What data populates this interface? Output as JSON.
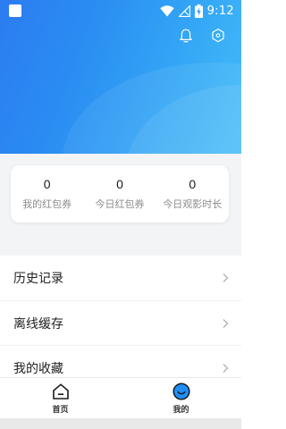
{
  "status_bar": {
    "time": "9:12",
    "icons": [
      "app-notification-icon",
      "wifi-icon",
      "no-signal-icon",
      "battery-charging-icon"
    ]
  },
  "header": {
    "icons": [
      "bell-icon",
      "settings-hexagon-icon"
    ],
    "gradient_colors": [
      "#2c7cf0",
      "#45bdf8"
    ]
  },
  "stats": [
    {
      "value": "0",
      "label": "我的红包券"
    },
    {
      "value": "0",
      "label": "今日红包券"
    },
    {
      "value": "0",
      "label": "今日观影时长"
    }
  ],
  "menu": [
    {
      "label": "历史记录"
    },
    {
      "label": "离线缓存"
    },
    {
      "label": "我的收藏"
    }
  ],
  "tabs": [
    {
      "label": "首页",
      "icon": "home-icon",
      "active": false
    },
    {
      "label": "我的",
      "icon": "profile-face-icon",
      "active": true
    }
  ],
  "colors": {
    "accent": "#2a8ef2",
    "tab_active": "#1f8ef5"
  }
}
